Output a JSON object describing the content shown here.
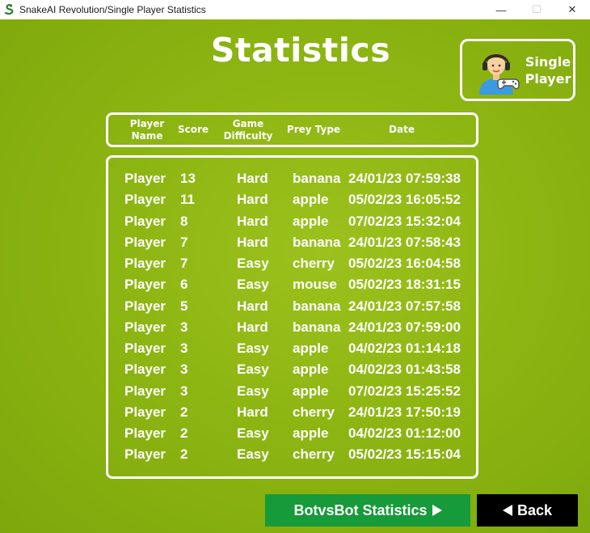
{
  "window": {
    "title": "SnakeAI Revolution/Single Player Statistics",
    "minimize_glyph": "—",
    "maximize_glyph": "☐",
    "close_glyph": "✕"
  },
  "heading": "Statistics",
  "mode_badge": {
    "line1": "Single",
    "line2": "Player",
    "icon": "gamer-avatar-icon"
  },
  "columns": [
    {
      "line1": "Player",
      "line2": "Name"
    },
    {
      "line1": "Score",
      "line2": ""
    },
    {
      "line1": "Game",
      "line2": "Difficulty"
    },
    {
      "line1": "Prey Type",
      "line2": ""
    },
    {
      "line1": "Date",
      "line2": ""
    }
  ],
  "rows": [
    {
      "name": "Player",
      "score": "13",
      "difficulty": "Hard",
      "prey": "banana",
      "date": "24/01/23 07:59:38"
    },
    {
      "name": "Player",
      "score": "11",
      "difficulty": "Hard",
      "prey": "apple",
      "date": "05/02/23 16:05:52"
    },
    {
      "name": "Player",
      "score": "8",
      "difficulty": "Hard",
      "prey": "apple",
      "date": "07/02/23 15:32:04"
    },
    {
      "name": "Player",
      "score": "7",
      "difficulty": "Hard",
      "prey": "banana",
      "date": "24/01/23 07:58:43"
    },
    {
      "name": "Player",
      "score": "7",
      "difficulty": "Easy",
      "prey": "cherry",
      "date": "05/02/23 16:04:58"
    },
    {
      "name": "Player",
      "score": "6",
      "difficulty": "Easy",
      "prey": "mouse",
      "date": "05/02/23 18:31:15"
    },
    {
      "name": "Player",
      "score": "5",
      "difficulty": "Hard",
      "prey": "banana",
      "date": "24/01/23 07:57:58"
    },
    {
      "name": "Player",
      "score": "3",
      "difficulty": "Hard",
      "prey": "banana",
      "date": "24/01/23 07:59:00"
    },
    {
      "name": "Player",
      "score": "3",
      "difficulty": "Easy",
      "prey": "apple",
      "date": "04/02/23 01:14:18"
    },
    {
      "name": "Player",
      "score": "3",
      "difficulty": "Easy",
      "prey": "apple",
      "date": "04/02/23 01:43:58"
    },
    {
      "name": "Player",
      "score": "3",
      "difficulty": "Easy",
      "prey": "apple",
      "date": "07/02/23 15:25:52"
    },
    {
      "name": "Player",
      "score": "2",
      "difficulty": "Hard",
      "prey": "cherry",
      "date": "24/01/23 17:50:19"
    },
    {
      "name": "Player",
      "score": "2",
      "difficulty": "Easy",
      "prey": "apple",
      "date": "04/02/23 01:12:00"
    },
    {
      "name": "Player",
      "score": "2",
      "difficulty": "Easy",
      "prey": "cherry",
      "date": "05/02/23 15:15:04"
    }
  ],
  "buttons": {
    "bot_stats_label": "BotvsBot Statistics",
    "back_label": "Back"
  },
  "colors": {
    "background": "#8db512",
    "bot_button": "#169a3a",
    "back_button": "#000000",
    "text": "#ffffff"
  }
}
